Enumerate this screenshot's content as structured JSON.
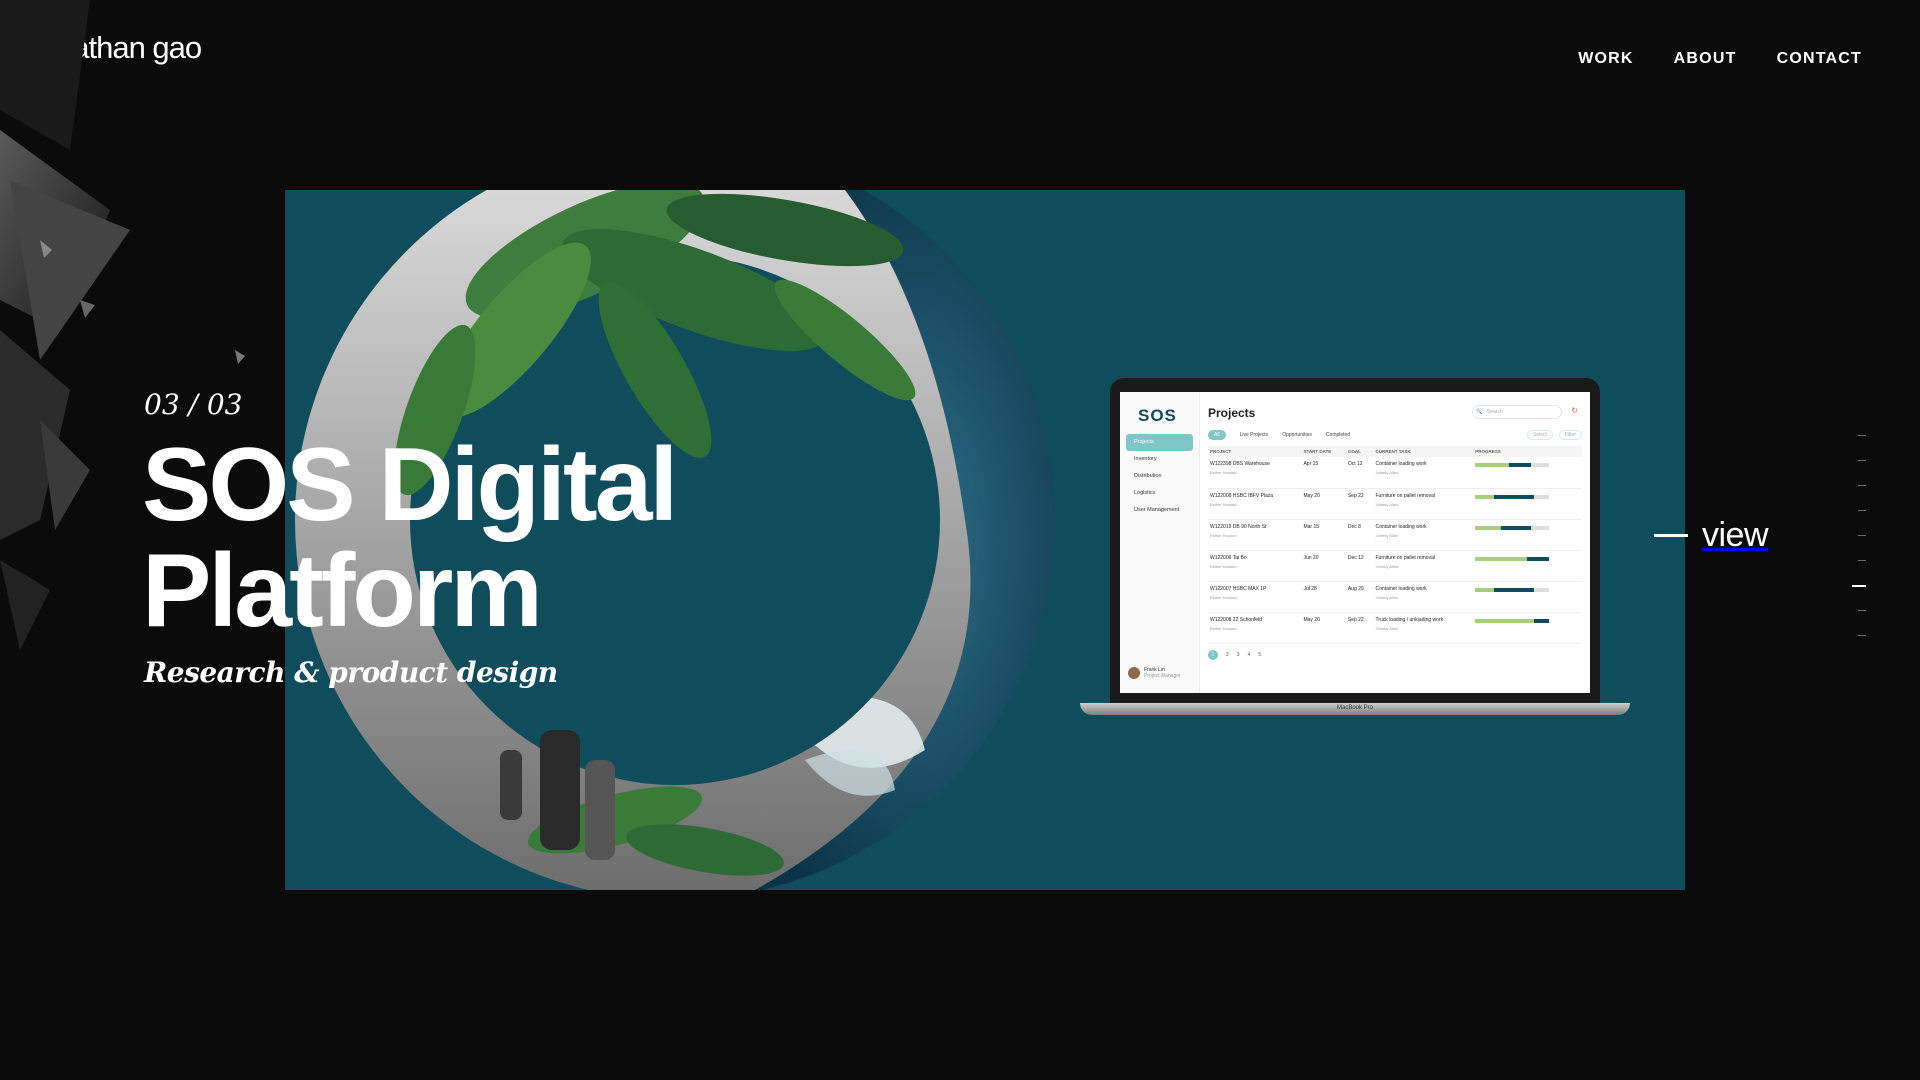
{
  "header": {
    "logo": "nathan gao",
    "nav": [
      {
        "label": "WORK"
      },
      {
        "label": "ABOUT"
      },
      {
        "label": "CONTACT"
      }
    ]
  },
  "project": {
    "counter": "03 / 03",
    "title_line1": "SOS Digital",
    "title_line2": "Platform",
    "subtitle": "Research & product design",
    "view_label": "view"
  },
  "slider": {
    "total": 9,
    "active_index": 6
  },
  "colors": {
    "background": "#0b0b0b",
    "panel": "#0f4c5c",
    "accent": "#7fc6c7",
    "progress_green": "#a6cf7d"
  },
  "laptop": {
    "model_label": "MacBook Pro",
    "app": {
      "logo": "SOS",
      "page_title": "Projects",
      "search_placeholder": "Search",
      "sidebar": [
        "Projects",
        "Inventory",
        "Distribution",
        "Logistics",
        "User Management"
      ],
      "user": {
        "name": "Frank Lin",
        "role": "Project Manager"
      },
      "tabs": [
        "All",
        "Live Projects",
        "Opportunities",
        "Completed"
      ],
      "tab_actions": [
        "Select",
        "Filter"
      ],
      "columns": [
        "PROJECT",
        "START DATE",
        "GOAL",
        "CURRENT TASK",
        "PROGRESS"
      ],
      "rows": [
        {
          "project": "W122398 DBS Warehouse",
          "sub": "Esther Howard",
          "start": "Apr 15",
          "goal": "Oct 12",
          "task": "Container loading work",
          "task_sub": "Johnny Allen",
          "green": 0.45,
          "dark": 0.3
        },
        {
          "project": "W122008 HSBC IBFV Plaza",
          "sub": "Esther Howard",
          "start": "May 20",
          "goal": "Sep 22",
          "task": "Furniture on pallet removal",
          "task_sub": "Johnny Allen",
          "green": 0.25,
          "dark": 0.55
        },
        {
          "project": "W122019 DB 90 North St",
          "sub": "Esther Howard",
          "start": "Mar 15",
          "goal": "Dec 8",
          "task": "Container loading work",
          "task_sub": "Johnny Allen",
          "green": 0.35,
          "dark": 0.4
        },
        {
          "project": "W122006 Tai Bo",
          "sub": "Esther Howard",
          "start": "Jun 20",
          "goal": "Dec 12",
          "task": "Furniture on pallet removal",
          "task_sub": "Johnny Allen",
          "green": 0.7,
          "dark": 0.3
        },
        {
          "project": "W122007 HSBC MAX 1P",
          "sub": "Esther Howard",
          "start": "Jul 28",
          "goal": "Aug 29",
          "task": "Container loading work",
          "task_sub": "Johnny Allen",
          "green": 0.25,
          "dark": 0.55
        },
        {
          "project": "W122008 22 Schonfeld",
          "sub": "Esther Howard",
          "start": "May 20",
          "goal": "Sep 22",
          "task": "Truck loading / unloading work",
          "task_sub": "Johnny Allen",
          "green": 0.8,
          "dark": 0.2
        }
      ],
      "pages": [
        "1",
        "2",
        "3",
        "4",
        "5"
      ]
    }
  }
}
